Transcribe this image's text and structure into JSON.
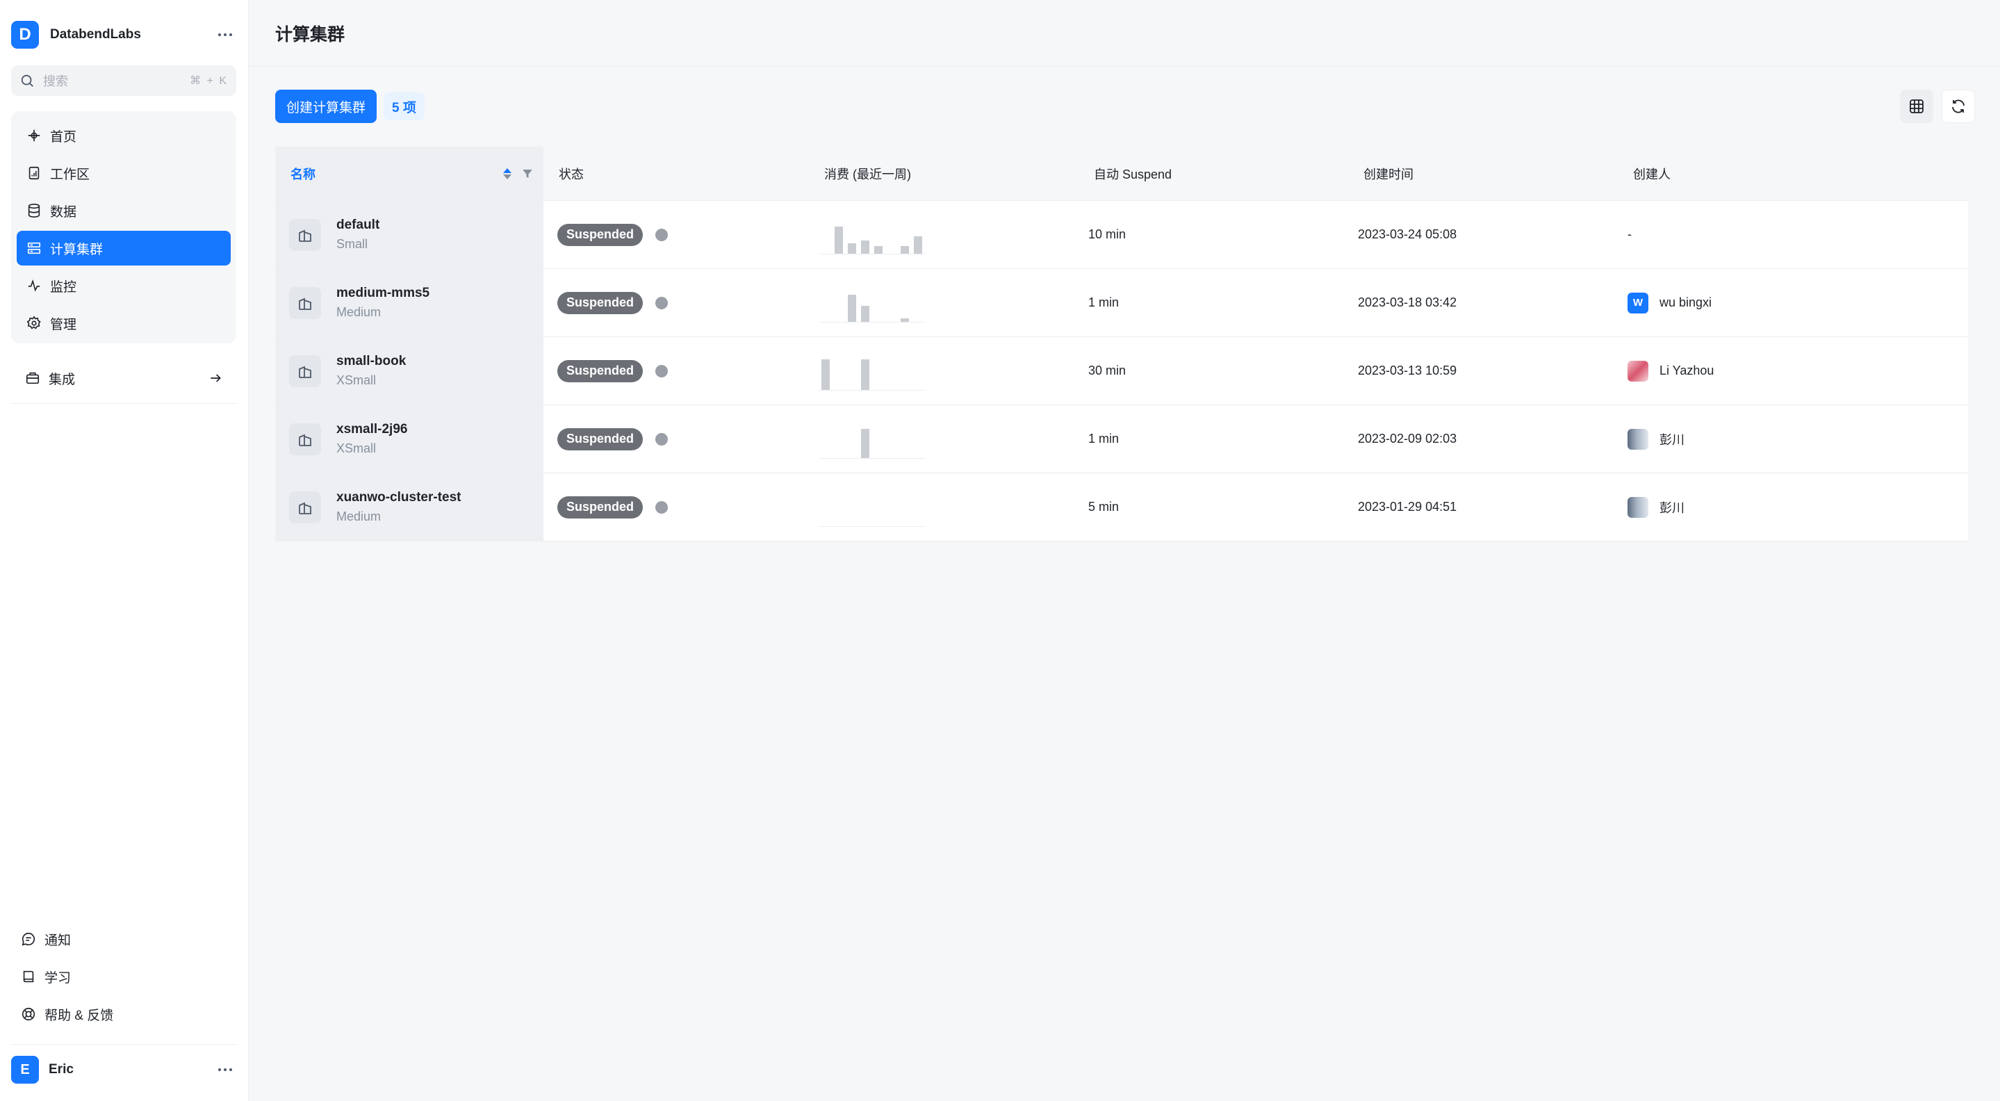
{
  "org": {
    "initial": "D",
    "name": "DatabendLabs"
  },
  "search": {
    "placeholder": "搜索",
    "shortcut": "⌘ + K"
  },
  "nav": [
    {
      "label": "首页",
      "icon": "home-icon"
    },
    {
      "label": "工作区",
      "icon": "worksheet-icon"
    },
    {
      "label": "数据",
      "icon": "database-icon"
    },
    {
      "label": "计算集群",
      "icon": "cluster-icon",
      "active": true
    },
    {
      "label": "监控",
      "icon": "activity-icon"
    },
    {
      "label": "管理",
      "icon": "gear-icon"
    }
  ],
  "integrations": {
    "label": "集成"
  },
  "bottom_nav": [
    {
      "label": "通知",
      "icon": "chat-bubble-icon"
    },
    {
      "label": "学习",
      "icon": "book-icon"
    },
    {
      "label": "帮助 & 反馈",
      "icon": "lifebuoy-icon"
    }
  ],
  "user": {
    "initial": "E",
    "name": "Eric"
  },
  "page": {
    "title": "计算集群"
  },
  "toolbar": {
    "create_label": "创建计算集群",
    "count_label": "5 项"
  },
  "table": {
    "headers": {
      "name": "名称",
      "status": "状态",
      "cost": "消费 (最近一周)",
      "auto_suspend": "自动 Suspend",
      "created_at": "创建时间",
      "creator": "创建人"
    },
    "rows": [
      {
        "name": "default",
        "size": "Small",
        "status": "Suspended",
        "cost_week": [
          0,
          0.75,
          0.28,
          0.36,
          0.22,
          0,
          0.22,
          0.48
        ],
        "auto_suspend": "10 min",
        "created_at": "2023-03-24 05:08",
        "creator": "-",
        "creator_avatar": ""
      },
      {
        "name": "medium-mms5",
        "size": "Medium",
        "status": "Suspended",
        "cost_week": [
          0,
          0,
          0.75,
          0.45,
          0,
          0,
          0.1,
          0
        ],
        "auto_suspend": "1 min",
        "created_at": "2023-03-18 03:42",
        "creator": "wu bingxi",
        "creator_avatar": "W"
      },
      {
        "name": "small-book",
        "size": "XSmall",
        "status": "Suspended",
        "cost_week": [
          0.85,
          0,
          0,
          0.85,
          0,
          0,
          0,
          0
        ],
        "auto_suspend": "30 min",
        "created_at": "2023-03-13 10:59",
        "creator": "Li Yazhou",
        "creator_avatar": ""
      },
      {
        "name": "xsmall-2j96",
        "size": "XSmall",
        "status": "Suspended",
        "cost_week": [
          0,
          0,
          0,
          0.8,
          0,
          0,
          0,
          0
        ],
        "auto_suspend": "1 min",
        "created_at": "2023-02-09 02:03",
        "creator": "彭川",
        "creator_avatar": ""
      },
      {
        "name": "xuanwo-cluster-test",
        "size": "Medium",
        "status": "Suspended",
        "cost_week": [
          0,
          0,
          0,
          0,
          0,
          0,
          0,
          0
        ],
        "auto_suspend": "5 min",
        "created_at": "2023-01-29 04:51",
        "creator": "彭川",
        "creator_avatar": ""
      }
    ]
  },
  "colors": {
    "accent": "#1677ff",
    "status_pill": "#6b6f75",
    "status_dot": "#9a9ea6"
  }
}
